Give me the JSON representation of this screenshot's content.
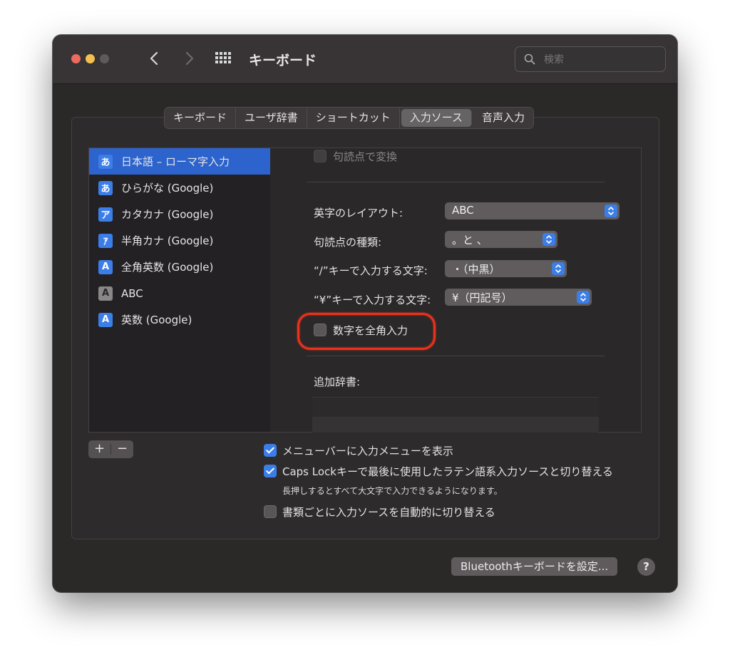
{
  "window": {
    "title": "キーボード",
    "search_placeholder": "検索"
  },
  "tabs": [
    {
      "label": "キーボード",
      "active": false
    },
    {
      "label": "ユーザ辞書",
      "active": false
    },
    {
      "label": "ショートカット",
      "active": false
    },
    {
      "label": "入力ソース",
      "active": true
    },
    {
      "label": "音声入力",
      "active": false
    }
  ],
  "input_sources": [
    {
      "badge": "あ",
      "label": "日本語 – ローマ字入力",
      "selected": true
    },
    {
      "badge": "あ",
      "label": "ひらがな (Google)",
      "selected": false
    },
    {
      "badge": "ア",
      "label": "カタカナ (Google)",
      "selected": false
    },
    {
      "badge": "ｱ",
      "label": "半角カナ (Google)",
      "selected": false
    },
    {
      "badge": "A",
      "label": "全角英数 (Google)",
      "selected": false
    },
    {
      "badge": "A",
      "label": "ABC",
      "selected": false
    },
    {
      "badge": "A",
      "label": "英数 (Google)",
      "selected": false
    }
  ],
  "options": {
    "punctuation_convert_label": "句読点で変換",
    "english_layout_label": "英字のレイアウト:",
    "english_layout_value": "ABC",
    "punctuation_type_label": "句読点の種類:",
    "punctuation_type_value": "。と 、",
    "slash_key_label": "“/”キーで入力する文字:",
    "slash_key_value": "・（中黒）",
    "yen_key_label": "“¥”キーで入力する文字:",
    "yen_key_value": "¥（円記号）",
    "fullwidth_numbers_label": "数字を全角入力",
    "additional_dict_label": "追加辞書:"
  },
  "list_controls": {
    "add": "+",
    "remove": "−"
  },
  "bottom": {
    "show_menu_label": "メニューバーに入力メニューを表示",
    "show_menu_checked": true,
    "capslock_label": "Caps Lockキーで最後に使用したラテン語系入力ソースと切り替える",
    "capslock_checked": true,
    "capslock_note": "長押しするとすべて大文字で入力できるようになります。",
    "auto_switch_label": "書類ごとに入力ソースを自動的に切り替える",
    "auto_switch_checked": false,
    "bluetooth_button": "Bluetoothキーボードを設定...",
    "help": "?"
  },
  "colors": {
    "accent": "#3c7ee8",
    "selection": "#2c63cc",
    "highlight_annotation": "#e8321c"
  }
}
